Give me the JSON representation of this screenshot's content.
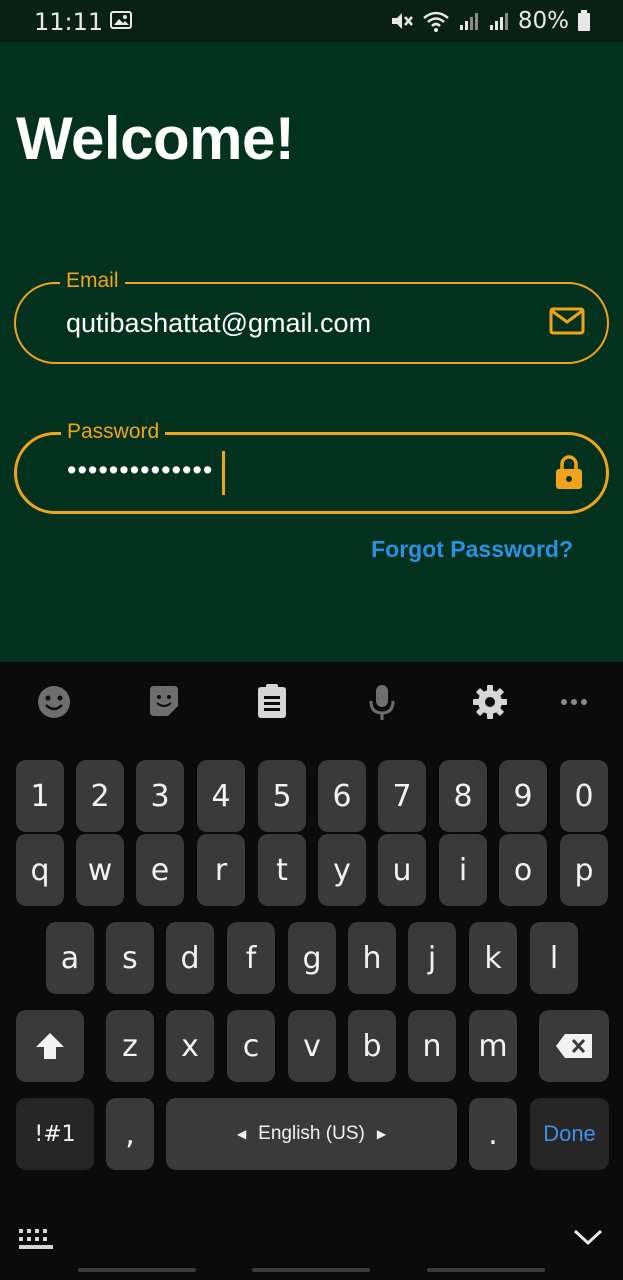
{
  "status_bar": {
    "time": "11:11",
    "battery": "80%",
    "icons": [
      "gallery-icon",
      "mute-icon",
      "wifi-icon",
      "signal-icon",
      "signal-icon",
      "battery-icon"
    ]
  },
  "screen": {
    "title": "Welcome!",
    "email": {
      "label": "Email",
      "value": "qutibashattat@gmail.com",
      "icon": "mail-icon"
    },
    "password": {
      "label": "Password",
      "value": "••••••••••••••",
      "icon": "lock-icon"
    },
    "forgot_password": "Forgot Password?"
  },
  "keyboard": {
    "toolbar": [
      "emoji-icon",
      "sticker-icon",
      "clipboard-icon",
      "microphone-icon",
      "settings-icon",
      "more-icon"
    ],
    "number_row": [
      "1",
      "2",
      "3",
      "4",
      "5",
      "6",
      "7",
      "8",
      "9",
      "0"
    ],
    "row1": [
      "q",
      "w",
      "e",
      "r",
      "t",
      "y",
      "u",
      "i",
      "o",
      "p"
    ],
    "row2": [
      "a",
      "s",
      "d",
      "f",
      "g",
      "h",
      "j",
      "k",
      "l"
    ],
    "row3": [
      "z",
      "x",
      "c",
      "v",
      "b",
      "n",
      "m"
    ],
    "symbols": "!#1",
    "comma": ",",
    "language": "English (US)",
    "period": ".",
    "done": "Done"
  },
  "colors": {
    "app_background": "#02311e",
    "accent": "#f2a31a",
    "link": "#2e8fe0",
    "keyboard_background": "#0b0b0b",
    "key": "#3a3a3a"
  }
}
